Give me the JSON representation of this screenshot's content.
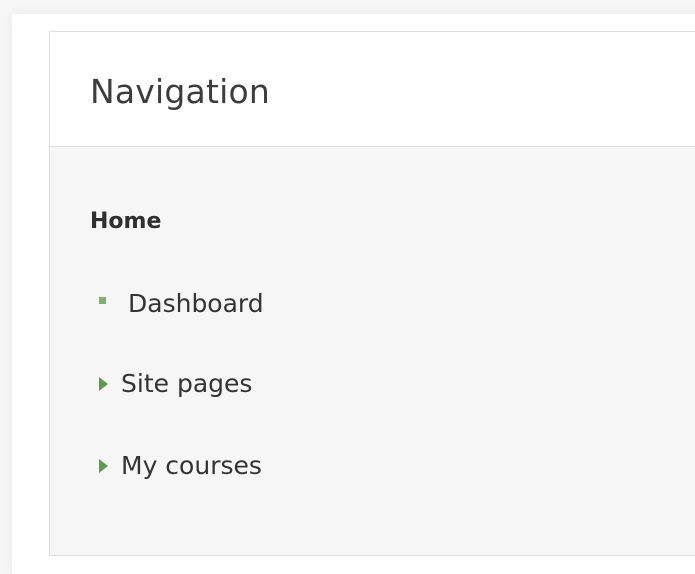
{
  "navigation": {
    "title": "Navigation",
    "home_label": "Home",
    "items": [
      {
        "label": "Dashboard",
        "icon": "square-bullet-icon",
        "expandable": false
      },
      {
        "label": "Site pages",
        "icon": "caret-right-icon",
        "expandable": true
      },
      {
        "label": "My courses",
        "icon": "caret-right-icon",
        "expandable": true
      }
    ]
  },
  "colors": {
    "accent": "#7fb06e",
    "arrow": "#5f9a50",
    "header_bg": "#ffffff",
    "body_bg": "#f6f6f6",
    "text": "#333333"
  }
}
